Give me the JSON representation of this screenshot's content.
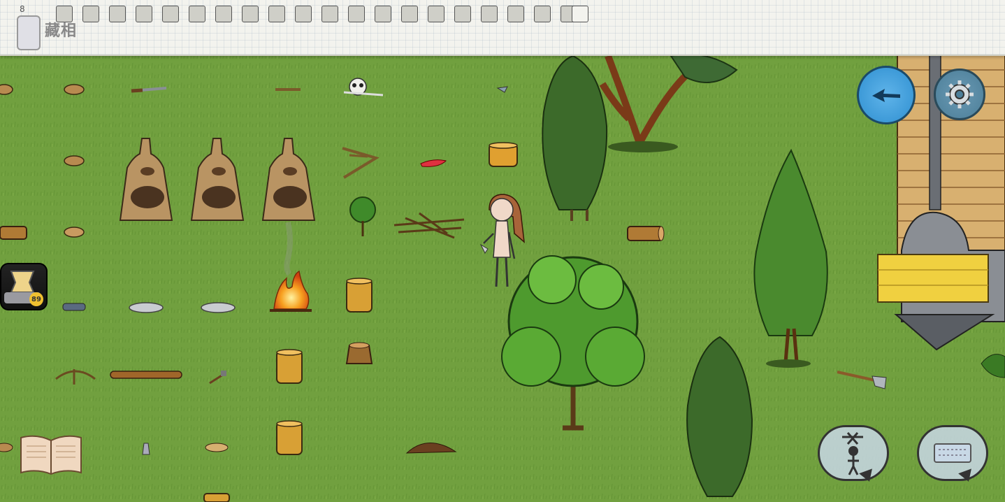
{
  "hud": {
    "player_name": "藏相",
    "age_marker": "8",
    "age_badge": "89",
    "inventory_slots": 21,
    "buttons": {
      "home": "home-arrow-icon",
      "settings": "gear-icon",
      "book": "recipe-book-icon",
      "emote": "puppet-icon",
      "chat": "keyboard-icon"
    },
    "colors": {
      "grass": "#6a9a3a",
      "paper": "#f3f3ee",
      "home_button": "#2f8fd0",
      "settings_button": "#4c7e98"
    }
  }
}
